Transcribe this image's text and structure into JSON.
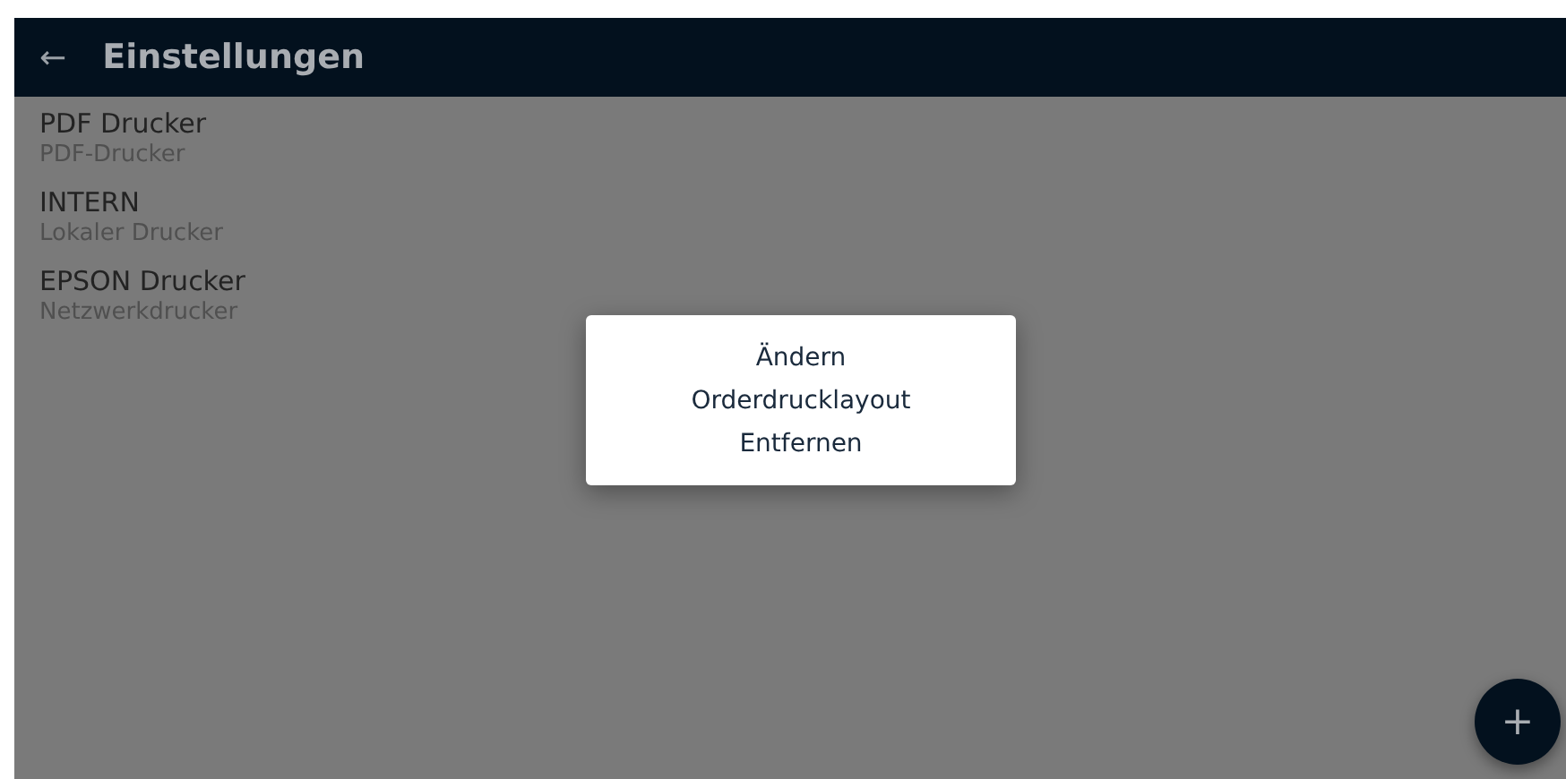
{
  "app_bar": {
    "back": "←",
    "title": "Einstellungen"
  },
  "printers": [
    {
      "name": "PDF Drucker",
      "type": "PDF-Drucker"
    },
    {
      "name": "INTERN",
      "type": "Lokaler Drucker"
    },
    {
      "name": "EPSON Drucker",
      "type": "Netzwerkdrucker"
    }
  ],
  "menu": [
    "Ändern",
    "Orderdrucklayout",
    "Entfernen"
  ],
  "fab": "+"
}
